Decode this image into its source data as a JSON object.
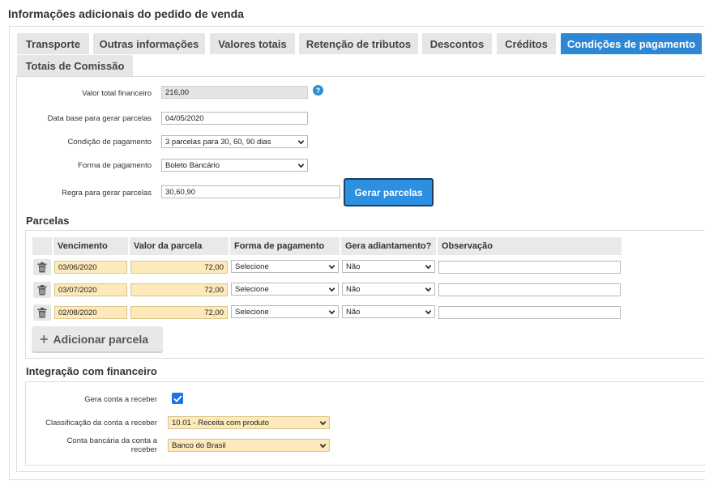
{
  "page": {
    "title": "Informações adicionais do pedido de venda"
  },
  "tabs": [
    {
      "label": "Transporte",
      "active": false
    },
    {
      "label": "Outras informações",
      "active": false
    },
    {
      "label": "Valores totais",
      "active": false
    },
    {
      "label": "Retenção de tributos",
      "active": false
    },
    {
      "label": "Descontos",
      "active": false
    },
    {
      "label": "Créditos",
      "active": false
    },
    {
      "label": "Condições de pagamento",
      "active": true
    },
    {
      "label": "Totais de Comissão",
      "active": false
    }
  ],
  "payment": {
    "total_label": "Valor total financeiro",
    "total_value": "216,00",
    "help_icon": "?",
    "base_date_label": "Data base para gerar parcelas",
    "base_date_value": "04/05/2020",
    "condition_label": "Condição de pagamento",
    "condition_value": "3 parcelas para 30, 60, 90 dias",
    "method_label": "Forma de pagamento",
    "method_value": "Boleto Bancário",
    "rule_label": "Regra para gerar parcelas",
    "rule_value": "30,60,90",
    "generate_button": "Gerar parcelas"
  },
  "installments": {
    "title": "Parcelas",
    "headers": [
      "Vencimento",
      "Valor da parcela",
      "Forma de pagamento",
      "Gera adiantamento?",
      "Observação"
    ],
    "rows": [
      {
        "due": "03/06/2020",
        "value": "72,00",
        "method": "Selecione",
        "advance": "Não",
        "note": ""
      },
      {
        "due": "03/07/2020",
        "value": "72,00",
        "method": "Selecione",
        "advance": "Não",
        "note": ""
      },
      {
        "due": "02/08/2020",
        "value": "72,00",
        "method": "Selecione",
        "advance": "Não",
        "note": ""
      }
    ],
    "add_button": "Adicionar parcela",
    "add_icon": "+"
  },
  "financial": {
    "title": "Integração com financeiro",
    "generate_label": "Gera conta a receber",
    "generate_checked": true,
    "classification_label": "Classificação da conta a receber",
    "classification_value": "10.01 - Receita com produto",
    "bank_label_line1": "Conta bancária da conta a",
    "bank_label_line2": "receber",
    "bank_value": "Banco do Brasil"
  },
  "icons": {
    "trash": "trash-icon",
    "caret": "chevron-down-icon",
    "help": "help-icon",
    "check": "check-icon",
    "plus": "plus-icon"
  },
  "colors": {
    "accent": "#2d87d6",
    "highlight_field": "#fde9ba",
    "readonly_field": "#e4e4e4",
    "tab_inactive": "#e6e6e6"
  }
}
